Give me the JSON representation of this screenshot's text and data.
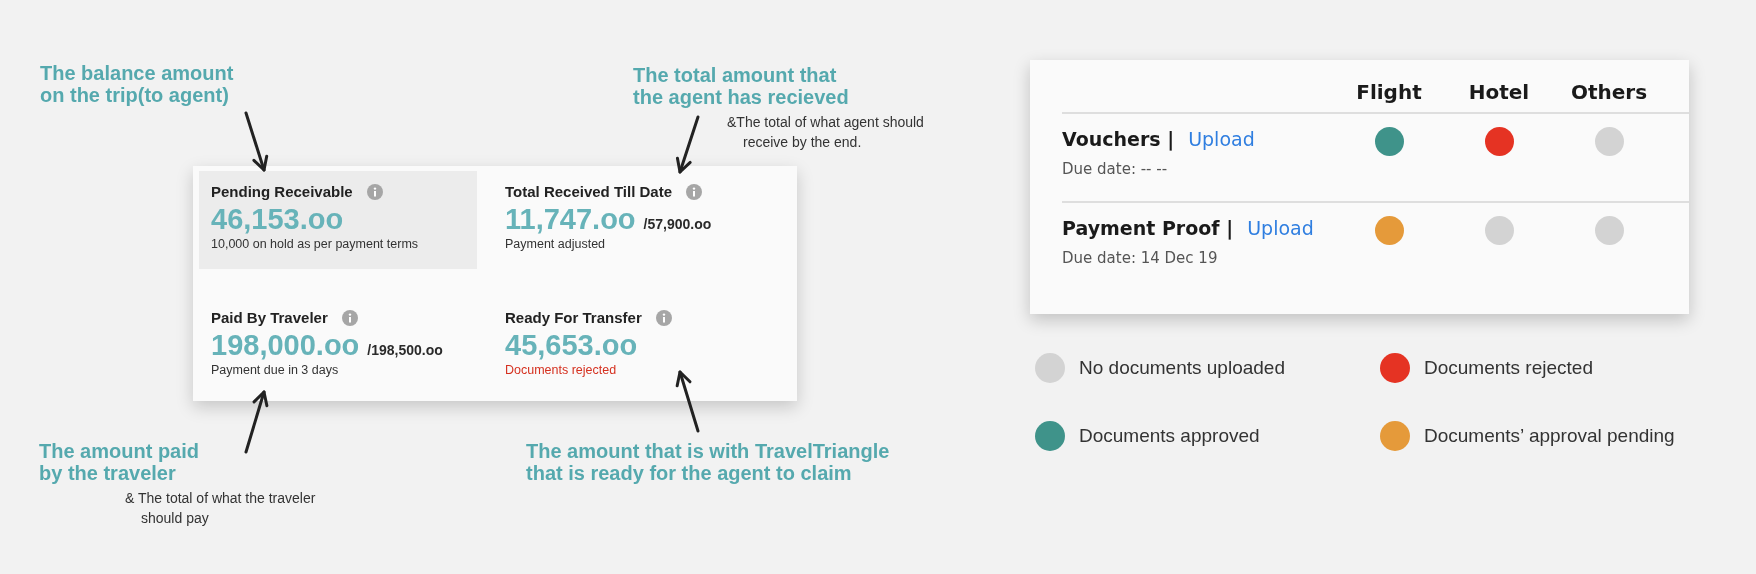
{
  "annotations": [
    {
      "title": "The balance amount\non the trip(to agent)"
    },
    {
      "title": "The total amount that\nthe agent has recieved",
      "note": "&The total of what agent should\nreceive by the end."
    },
    {
      "title": "The amount paid\nby the traveler",
      "note": "& The total of what the traveler\nshould pay"
    },
    {
      "title": "The amount that is with TravelTriangle\nthat is ready for the agent to claim"
    }
  ],
  "summary_card": {
    "tiles": [
      {
        "label": "Pending Receivable",
        "amount": "46,153.oo",
        "note": "10,000 on hold as per payment terms",
        "alert": false,
        "selected": true
      },
      {
        "label": "Total Received Till Date",
        "amount": "11,747.oo",
        "total": "/57,900.oo",
        "note": "Payment adjusted",
        "alert": false,
        "selected": false
      },
      {
        "label": "Paid By Traveler",
        "amount": "198,000.oo",
        "total": "/198,500.oo",
        "note": "Payment due in 3 days",
        "alert": false,
        "selected": false
      },
      {
        "label": "Ready For Transfer",
        "amount": "45,653.oo",
        "note": "Documents rejected",
        "alert": true,
        "selected": false
      }
    ]
  },
  "documents_card": {
    "columns": [
      "Flight",
      "Hotel",
      "Others"
    ],
    "rows": [
      {
        "name": "Vouchers |",
        "action": "Upload",
        "due": "Due date: -- --",
        "statuses": [
          {
            "color": "#3f938a"
          },
          {
            "color": "#e53323"
          },
          {
            "color": "#d3d3d3"
          }
        ]
      },
      {
        "name": "Payment Proof |",
        "action": "Upload",
        "due": "Due date: 14 Dec 19",
        "statuses": [
          {
            "color": "#e59a3a"
          },
          {
            "color": "#d3d3d3"
          },
          {
            "color": "#d3d3d3"
          }
        ]
      }
    ]
  },
  "legend": [
    {
      "color": "#d3d3d3",
      "label": "No documents uploaded"
    },
    {
      "color": "#e53323",
      "label": "Documents rejected"
    },
    {
      "color": "#3f938a",
      "label": "Documents approved"
    },
    {
      "color": "#e59a3a",
      "label": "Documents’ approval pending"
    }
  ]
}
